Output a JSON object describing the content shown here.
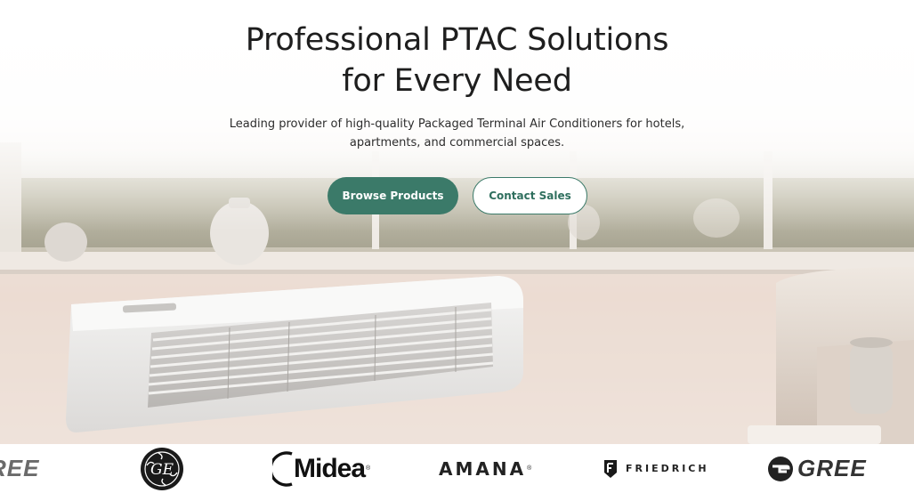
{
  "hero": {
    "title_line1": "Professional PTAC Solutions",
    "title_line2": "for Every Need",
    "subtitle_line1": "Leading provider of high-quality Packaged Terminal Air Conditioners for hotels,",
    "subtitle_line2": "apartments, and commercial spaces.",
    "primary_button": "Browse Products",
    "secondary_button": "Contact Sales"
  },
  "brands": {
    "items": [
      {
        "name": "REE",
        "icon": "gree-logo"
      },
      {
        "name": "GE",
        "icon": "ge-logo"
      },
      {
        "name": "Midea",
        "icon": "midea-logo"
      },
      {
        "name": "AMANA",
        "icon": "amana-logo"
      },
      {
        "name": "FRIEDRICH",
        "icon": "friedrich-logo"
      },
      {
        "name": "GREE",
        "icon": "gree-logo"
      }
    ]
  },
  "colors": {
    "accent": "#3b7a69",
    "background": "#ffffff"
  }
}
